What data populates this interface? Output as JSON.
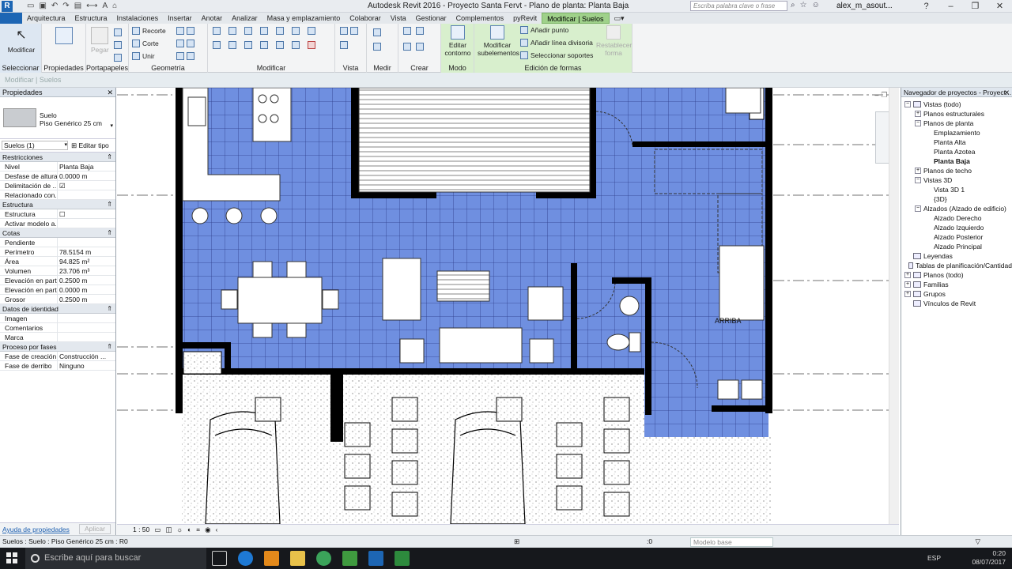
{
  "window": {
    "title": "Autodesk Revit 2016 -    Proyecto Santa Fervt - Plano de planta: Planta Baja",
    "search_placeholder": "Escriba palabra clave o frase",
    "user": "alex_m_asout...",
    "app_logo": "R"
  },
  "tabs": [
    {
      "label": "Arquitectura"
    },
    {
      "label": "Estructura"
    },
    {
      "label": "Instalaciones"
    },
    {
      "label": "Insertar"
    },
    {
      "label": "Anotar"
    },
    {
      "label": "Analizar"
    },
    {
      "label": "Masa y emplazamiento"
    },
    {
      "label": "Colaborar"
    },
    {
      "label": "Vista"
    },
    {
      "label": "Gestionar"
    },
    {
      "label": "Complementos"
    },
    {
      "label": "pyRevit"
    },
    {
      "label": "Modificar | Suelos"
    }
  ],
  "ribbon": {
    "modify_label": "Modificar",
    "select_panel": "Seleccionar",
    "properties_panel": "Propiedades",
    "clipboard_panel": "Portapapeles",
    "paste_label": "Pegar",
    "geometry_panel": "Geometría",
    "cut_label": "Recorte",
    "corte_label": "Corte",
    "join_label": "Unir",
    "modify_panel": "Modificar",
    "view_panel": "Vista",
    "measure_panel": "Medir",
    "create_panel": "Crear",
    "mode_panel": "Modo",
    "edit_boundary": "Editar contorno",
    "shape_panel": "Edición de formas",
    "modify_subelements": "Modificar subelementos",
    "add_point": "Añadir punto",
    "add_split_line": "Añadir línea divisoria",
    "pick_supports": "Seleccionar soportes",
    "reset_shape": "Restablecer forma"
  },
  "options_bar": {
    "text": "Modificar | Suelos"
  },
  "properties": {
    "title": "Propiedades",
    "type_family": "Suelo",
    "type_name": "Piso Genérico 25 cm",
    "instance_count": "Suelos (1)",
    "edit_type": "Editar tipo",
    "sections": [
      {
        "name": "Restricciones",
        "rows": [
          {
            "k": "Nivel",
            "v": "Planta Baja"
          },
          {
            "k": "Desfase de altura...",
            "v": "0.0000 m"
          },
          {
            "k": "Delimitación de ...",
            "v": "☑"
          },
          {
            "k": "Relacionado con...",
            "v": ""
          }
        ]
      },
      {
        "name": "Estructura",
        "rows": [
          {
            "k": "Estructura",
            "v": "☐"
          },
          {
            "k": "Activar modelo a...",
            "v": ""
          }
        ]
      },
      {
        "name": "Cotas",
        "rows": [
          {
            "k": "Pendiente",
            "v": ""
          },
          {
            "k": "Perímetro",
            "v": "78.5154 m"
          },
          {
            "k": "Área",
            "v": "94.825 m²"
          },
          {
            "k": "Volumen",
            "v": "23.706 m³"
          },
          {
            "k": "Elevación en part...",
            "v": "0.2500 m"
          },
          {
            "k": "Elevación en part...",
            "v": "0.0000 m"
          },
          {
            "k": "Grosor",
            "v": "0.2500 m"
          }
        ]
      },
      {
        "name": "Datos de identidad",
        "rows": [
          {
            "k": "Imagen",
            "v": ""
          },
          {
            "k": "Comentarios",
            "v": ""
          },
          {
            "k": "Marca",
            "v": ""
          }
        ]
      },
      {
        "name": "Proceso por fases",
        "rows": [
          {
            "k": "Fase de creación",
            "v": "Construcción ..."
          },
          {
            "k": "Fase de derribo",
            "v": "Ninguno"
          }
        ]
      }
    ],
    "help_link": "Ayuda de propiedades",
    "apply": "Aplicar"
  },
  "canvas": {
    "stair_label": "ARRIBA",
    "scale": "1 : 50",
    "floor_color": "#6f8fe0"
  },
  "browser": {
    "title": "Navegador de proyectos - Proyect...",
    "nodes": [
      {
        "label": "Vistas (todo)",
        "level": 0,
        "toggle": "−"
      },
      {
        "label": "Planos estructurales",
        "level": 1,
        "toggle": "+"
      },
      {
        "label": "Planos de planta",
        "level": 1,
        "toggle": "−"
      },
      {
        "label": "Emplazamiento",
        "level": 2,
        "toggle": ""
      },
      {
        "label": "Planta Alta",
        "level": 2,
        "toggle": ""
      },
      {
        "label": "Planta Azotea",
        "level": 2,
        "toggle": ""
      },
      {
        "label": "Planta Baja",
        "level": 2,
        "toggle": "",
        "selected": true
      },
      {
        "label": "Planos de techo",
        "level": 1,
        "toggle": "+"
      },
      {
        "label": "Vistas 3D",
        "level": 1,
        "toggle": "−"
      },
      {
        "label": "Vista 3D 1",
        "level": 2,
        "toggle": ""
      },
      {
        "label": "{3D}",
        "level": 2,
        "toggle": ""
      },
      {
        "label": "Alzados (Alzado de edificio)",
        "level": 1,
        "toggle": "−"
      },
      {
        "label": "Alzado Derecho",
        "level": 2,
        "toggle": ""
      },
      {
        "label": "Alzado Izquierdo",
        "level": 2,
        "toggle": ""
      },
      {
        "label": "Alzado Posterior",
        "level": 2,
        "toggle": ""
      },
      {
        "label": "Alzado Principal",
        "level": 2,
        "toggle": ""
      },
      {
        "label": "Leyendas",
        "level": 0,
        "toggle": ""
      },
      {
        "label": "Tablas de planificación/Cantidad",
        "level": 0,
        "toggle": ""
      },
      {
        "label": "Planos (todo)",
        "level": 0,
        "toggle": "+"
      },
      {
        "label": "Familias",
        "level": 0,
        "toggle": "+"
      },
      {
        "label": "Grupos",
        "level": 0,
        "toggle": "+"
      },
      {
        "label": "Vínculos de Revit",
        "level": 0,
        "toggle": ""
      }
    ]
  },
  "status": {
    "message": "Suelos : Suelo : Piso Genérico 25 cm : R0",
    "zero": ":0",
    "model": "Modelo base"
  },
  "taskbar": {
    "search": "Escribe aquí para buscar",
    "lang": "ESP",
    "time": "0:20",
    "date": "08/07/2017"
  }
}
